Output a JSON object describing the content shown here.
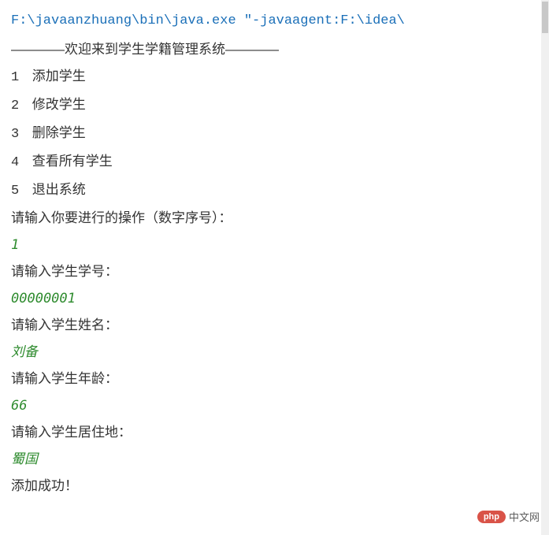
{
  "command": "F:\\javaanzhuang\\bin\\java.exe \"-javaagent:F:\\idea\\",
  "welcome": "————欢迎来到学生学籍管理系统————",
  "menu": [
    {
      "num": "1",
      "label": "添加学生"
    },
    {
      "num": "2",
      "label": "修改学生"
    },
    {
      "num": "3",
      "label": "删除学生"
    },
    {
      "num": "4",
      "label": "查看所有学生"
    },
    {
      "num": "5",
      "label": "退出系统"
    }
  ],
  "prompts": {
    "operation": "请输入你要进行的操作（数字序号）：",
    "student_id": "请输入学生学号：",
    "student_name": "请输入学生姓名：",
    "student_age": "请输入学生年龄：",
    "student_address": "请输入学生居住地："
  },
  "inputs": {
    "operation": "1",
    "student_id": "00000001",
    "student_name": "刘备",
    "student_age": "66",
    "student_address": "蜀国"
  },
  "result": "添加成功！",
  "watermark": {
    "badge": "php",
    "text": "中文网"
  }
}
